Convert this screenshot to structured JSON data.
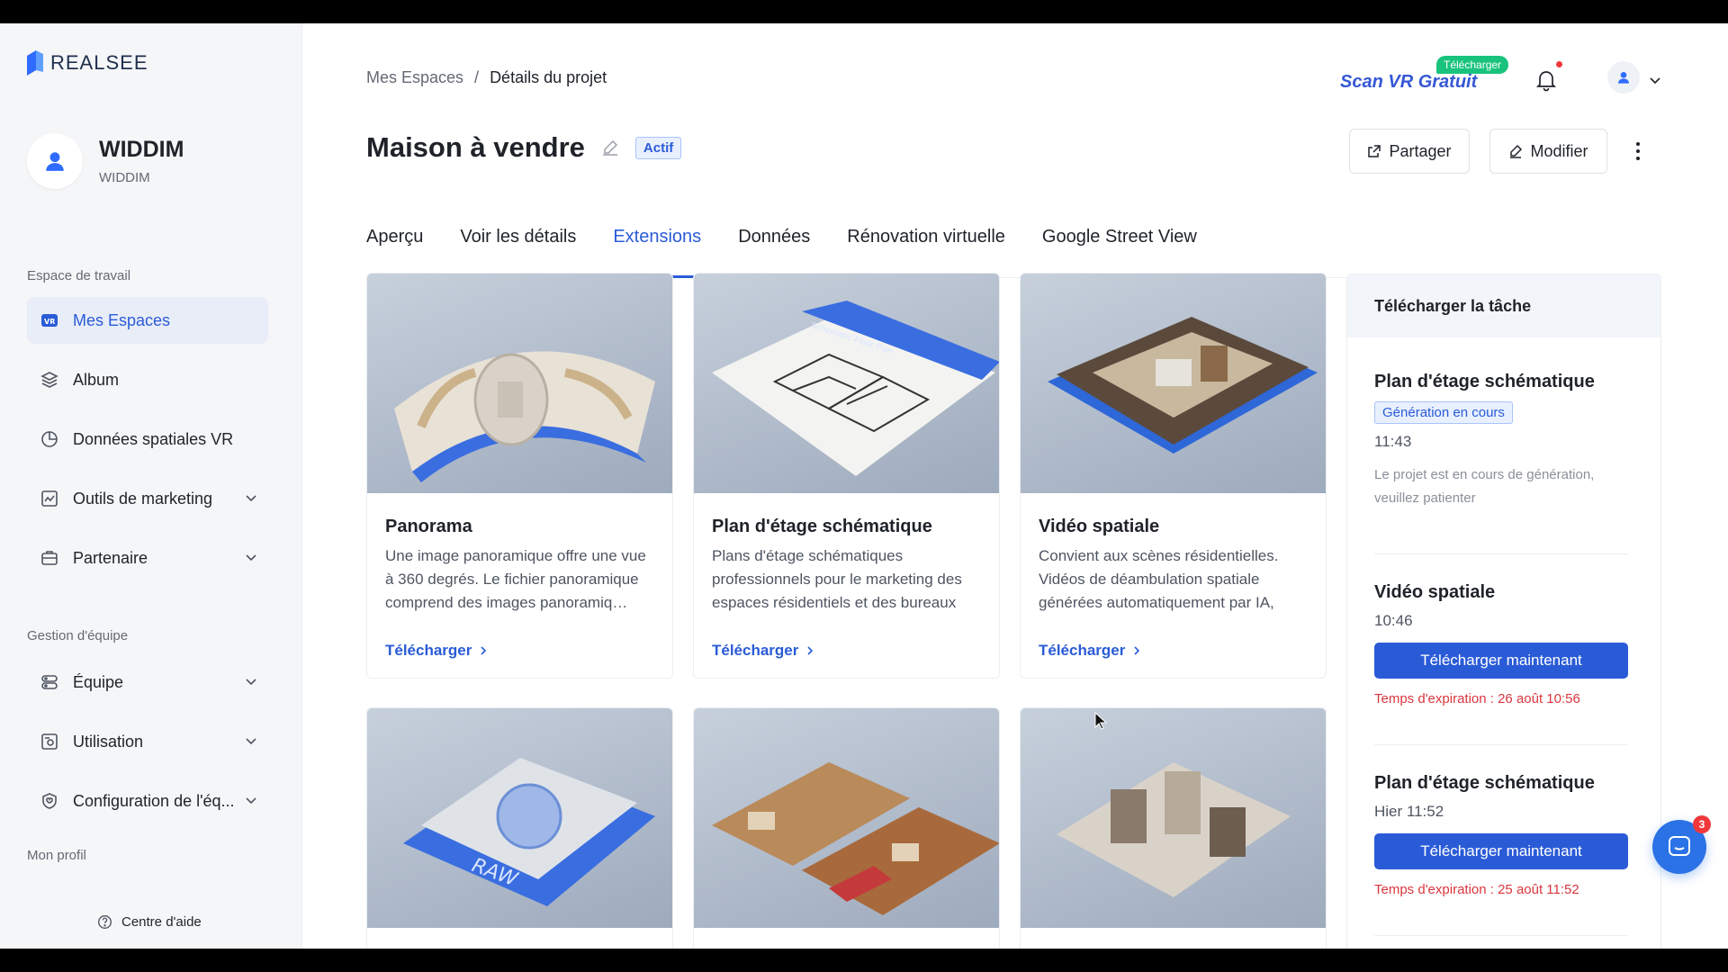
{
  "brand": {
    "name": "REALSEE"
  },
  "profile": {
    "name": "WIDDIM",
    "subtitle": "WIDDIM"
  },
  "sidebar": {
    "workspace_label": "Espace de travail",
    "team_label": "Gestion d'équipe",
    "my_profile_label": "Mon profil",
    "help_label": "Centre d'aide",
    "items": [
      {
        "label": "Mes Espaces",
        "icon": "vr-icon",
        "active": true
      },
      {
        "label": "Album",
        "icon": "layers-icon"
      },
      {
        "label": "Données spatiales VR",
        "icon": "pie-chart-icon"
      },
      {
        "label": "Outils de marketing",
        "icon": "chart-line-icon",
        "expandable": true
      },
      {
        "label": "Partenaire",
        "icon": "briefcase-icon",
        "expandable": true
      },
      {
        "label": "Équipe",
        "icon": "team-icon",
        "expandable": true
      },
      {
        "label": "Utilisation",
        "icon": "usage-icon",
        "expandable": true
      },
      {
        "label": "Configuration de l'éq...",
        "icon": "shield-heart-icon",
        "expandable": true
      }
    ]
  },
  "header": {
    "breadcrumb": [
      "Mes Espaces",
      "Détails du projet"
    ],
    "breadcrumb_sep": "/",
    "scan_vr": "Scan VR Gratuit",
    "scan_badge": "Télécharger"
  },
  "project": {
    "title": "Maison à vendre",
    "status": "Actif",
    "share_label": "Partager",
    "edit_label": "Modifier"
  },
  "tabs": [
    {
      "label": "Aperçu"
    },
    {
      "label": "Voir les détails"
    },
    {
      "label": "Extensions",
      "active": true
    },
    {
      "label": "Données"
    },
    {
      "label": "Rénovation virtuelle"
    },
    {
      "label": "Google Street View"
    }
  ],
  "cards": [
    {
      "title": "Panorama",
      "desc": "Une image panoramique offre une vue à 360 degrés. Le fichier panoramique comprend des images panoramiq…",
      "link": "Télécharger"
    },
    {
      "title": "Plan d'étage schématique",
      "desc": "Plans d'étage schématiques professionnels pour le marketing des espaces résidentiels et des bureaux commer…",
      "link": "Télécharger",
      "image_label": "Schematic Floor Plan"
    },
    {
      "title": "Vidéo spatiale",
      "desc": "Convient aux scènes résidentielles. Vidéos de déambulation spatiale générées automatiquement par IA, avec p…",
      "link": "Télécharger"
    },
    {
      "image_label": "RAW"
    },
    {},
    {}
  ],
  "panel": {
    "title": "Télécharger la tâche",
    "tasks": [
      {
        "title": "Plan d'étage schématique",
        "tag": "Génération en cours",
        "time": "11:43",
        "note": "Le projet est en cours de génération, veuillez patienter"
      },
      {
        "title": "Vidéo spatiale",
        "time": "10:46",
        "button": "Télécharger maintenant",
        "expire": "Temps d'expiration : 26 août 10:56"
      },
      {
        "title": "Plan d'étage schématique",
        "time": "Hier 11:52",
        "button": "Télécharger maintenant",
        "expire": "Temps d'expiration : 25 août 11:52"
      }
    ]
  },
  "chat": {
    "badge": "3"
  },
  "colors": {
    "accent": "#2a5bd7",
    "danger": "#d9363e",
    "success": "#19c37d"
  }
}
